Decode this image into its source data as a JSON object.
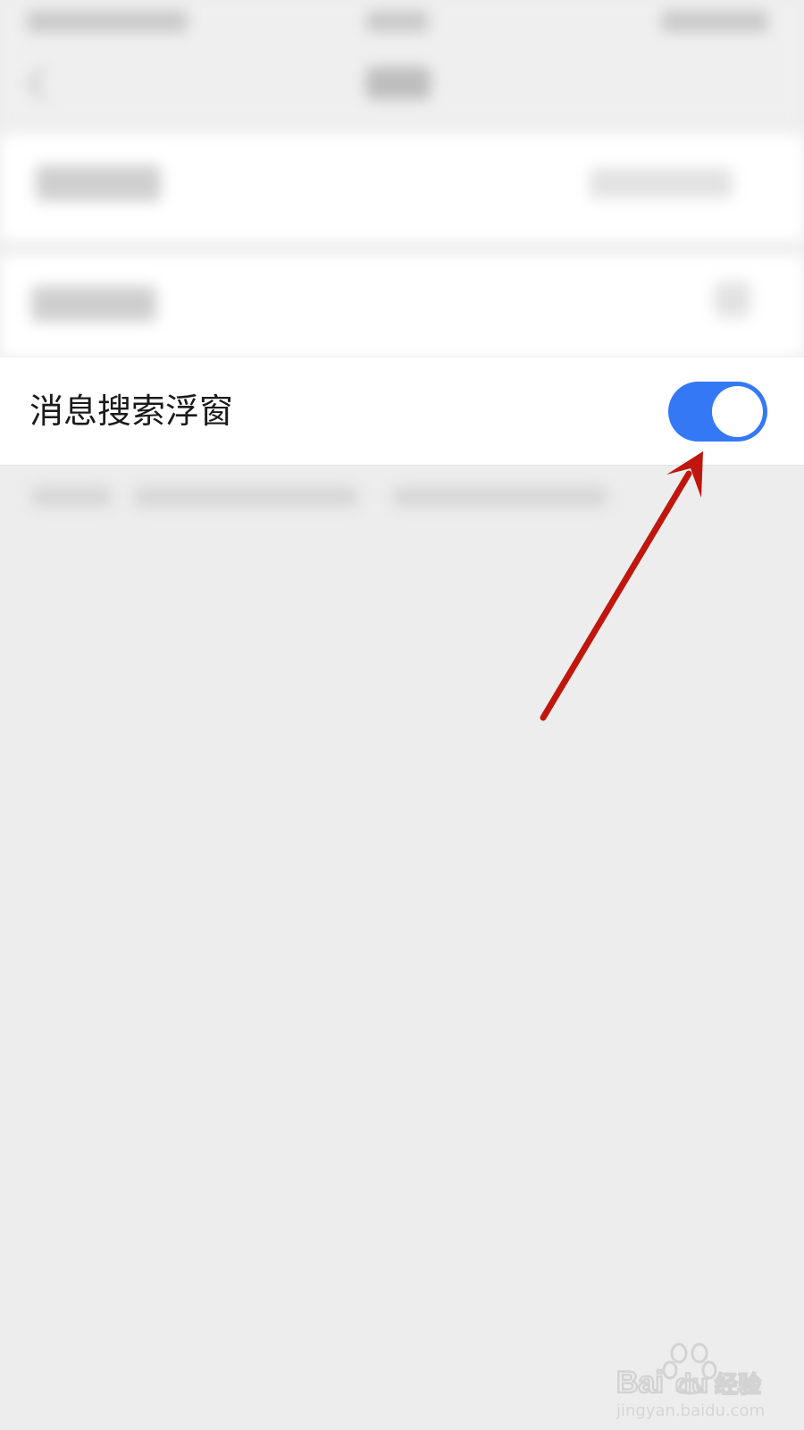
{
  "setting": {
    "label": "消息搜索浮窗",
    "enabled": true
  },
  "colors": {
    "toggle_on": "#3478f6",
    "annotation_arrow": "#c0160e",
    "background": "#ededed"
  },
  "icons": {
    "back": "chevron-left-icon",
    "annotation": "arrow-annotation"
  },
  "watermark": {
    "brand_a": "Bai",
    "brand_b": "du",
    "brand_cn": "经验",
    "url": "jingyan.baidu.com"
  }
}
